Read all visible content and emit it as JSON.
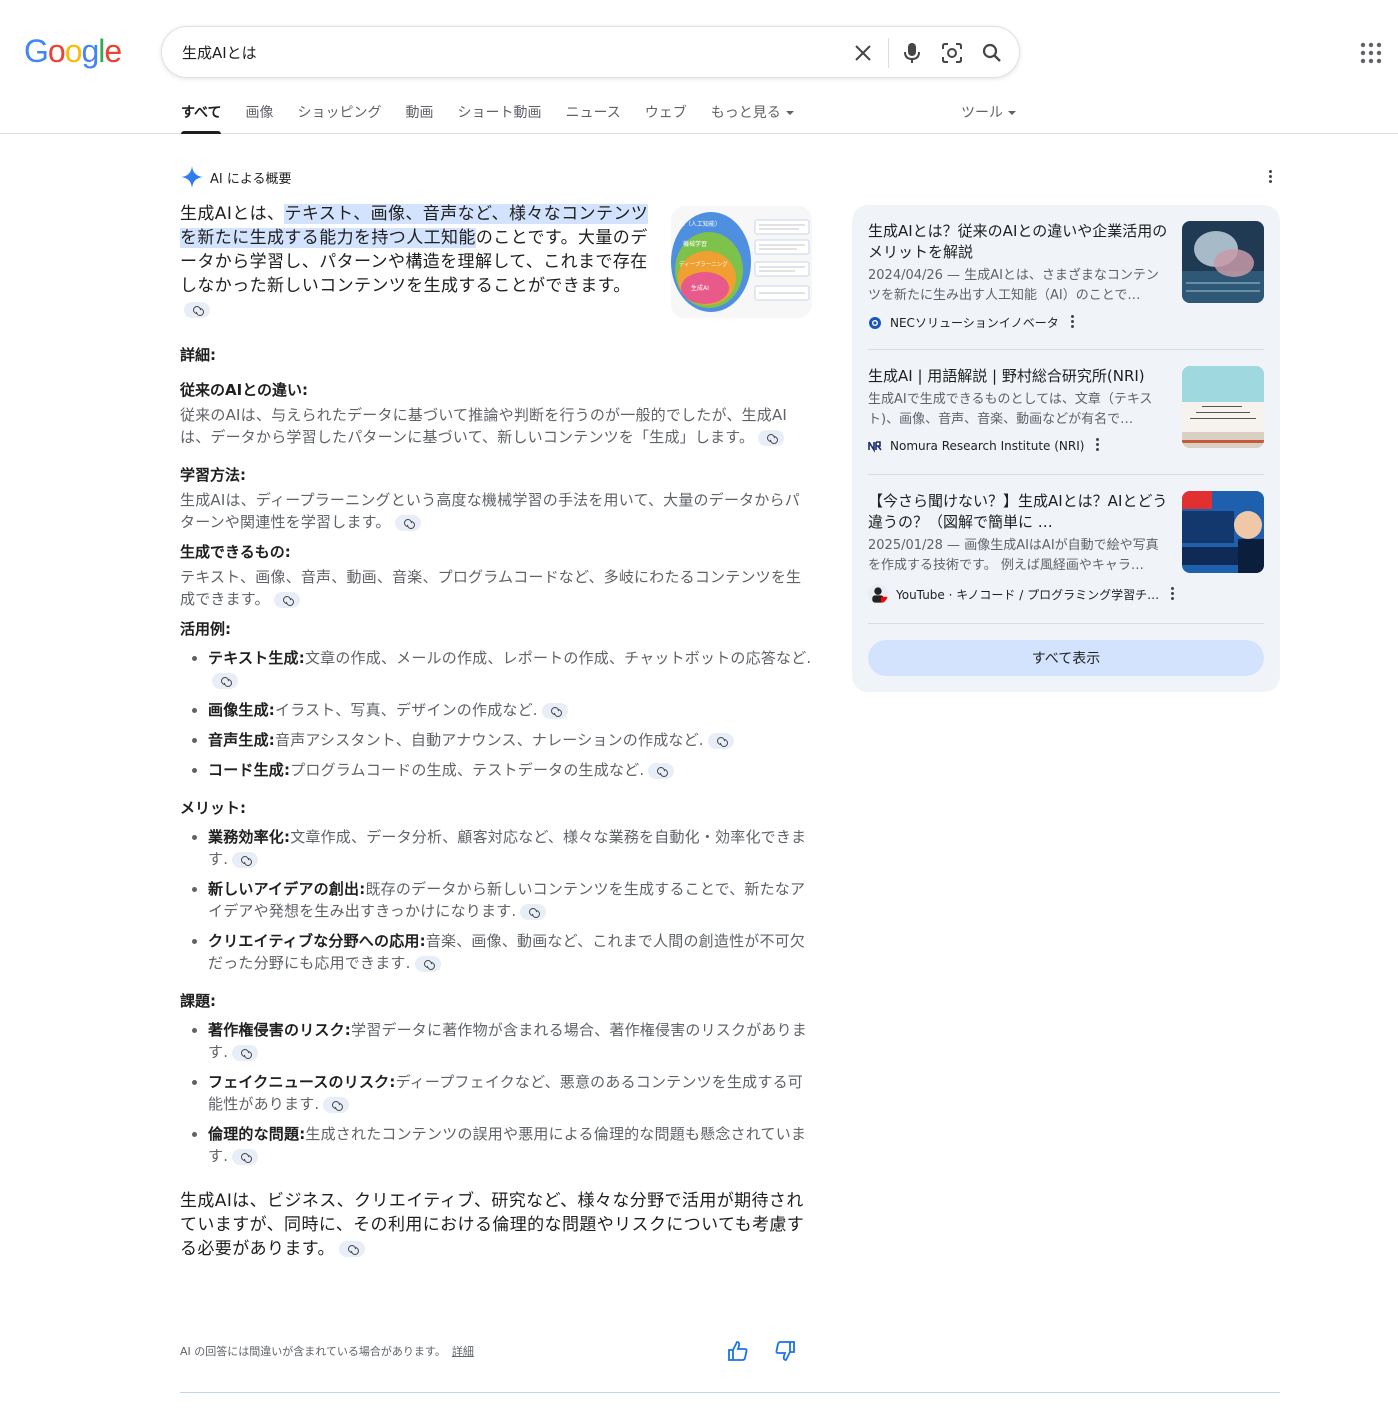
{
  "header": {
    "logo": [
      "G",
      "o",
      "o",
      "g",
      "l",
      "e"
    ],
    "logo_colors": [
      "#4285F4",
      "#EA4335",
      "#FBBC05",
      "#4285F4",
      "#34A853",
      "#EA4335"
    ],
    "query": "生成AIとは",
    "tabs": [
      "すべて",
      "画像",
      "ショッピング",
      "動画",
      "ショート動画",
      "ニュース",
      "ウェブ",
      "もっと見る"
    ],
    "tools": "ツール"
  },
  "ai": {
    "header_label": "AI による概要",
    "lead_pre": "生成AIとは、",
    "lead_hl": "テキスト、画像、音声など、様々なコンテンツを新たに生成する能力を持つ人工知能",
    "lead_post": "のことです。大量のデータから学習し、パターンや構造を理解して、これまで存在しなかった新しいコンテンツを生成することができます。",
    "details_title": "詳細:",
    "diff_title": "従来のAIとの違い:",
    "diff_text": "従来のAIは、与えられたデータに基づいて推論や判断を行うのが一般的でしたが、生成AIは、データから学習したパターンに基づいて、新しいコンテンツを「生成」します。",
    "learn_title": "学習方法:",
    "learn_text": "生成AIは、ディープラーニングという高度な機械学習の手法を用いて、大量のデータからパターンや関連性を学習します。",
    "can_title": "生成できるもの:",
    "can_text": "テキスト、画像、音声、動画、音楽、プログラムコードなど、多岐にわたるコンテンツを生成できます。",
    "use_title": "活用例:",
    "use_items": [
      {
        "b": "テキスト生成:",
        "t": "文章の作成、メールの作成、レポートの作成、チャットボットの応答など."
      },
      {
        "b": "画像生成:",
        "t": "イラスト、写真、デザインの作成など."
      },
      {
        "b": "音声生成:",
        "t": "音声アシスタント、自動アナウンス、ナレーションの作成など."
      },
      {
        "b": "コード生成:",
        "t": "プログラムコードの生成、テストデータの生成など."
      }
    ],
    "merit_title": "メリット:",
    "merit_items": [
      {
        "b": "業務効率化:",
        "t": "文章作成、データ分析、顧客対応など、様々な業務を自動化・効率化できます."
      },
      {
        "b": "新しいアイデアの創出:",
        "t": "既存のデータから新しいコンテンツを生成することで、新たなアイデアや発想を生み出すきっかけになります."
      },
      {
        "b": "クリエイティブな分野への応用:",
        "t": "音楽、画像、動画など、これまで人間の創造性が不可欠だった分野にも応用できます."
      }
    ],
    "issue_title": "課題:",
    "issue_items": [
      {
        "b": "著作権侵害のリスク:",
        "t": "学習データに著作物が含まれる場合、著作権侵害のリスクがあります."
      },
      {
        "b": "フェイクニュースのリスク:",
        "t": "ディープフェイクなど、悪意のあるコンテンツを生成する可能性があります."
      },
      {
        "b": "倫理的な問題:",
        "t": "生成されたコンテンツの誤用や悪用による倫理的な問題も懸念されています."
      }
    ],
    "closing": "生成AIは、ビジネス、クリエイティブ、研究など、様々な分野で活用が期待されていますが、同時に、その利用における倫理的な問題やリスクについても考慮する必要があります。",
    "footnote": "AI の回答には間違いが含まれている場合があります。",
    "footnote_link": "詳細",
    "diagram_labels": [
      "AI（人工知能）",
      "機械学習",
      "ディープラーニング",
      "生成AI"
    ],
    "diagram_colors": [
      "#4f8fe0",
      "#7dc24b",
      "#f0a030",
      "#e85a8a"
    ]
  },
  "sources": {
    "cards": [
      {
        "title": "生成AIとは？従来のAIとの違いや企業活用のメリットを解説",
        "snippet": "2024/04/26 — 生成AIとは、さまざまなコンテンツを新たに生み出す人工知能（AI）のことで…",
        "source": "NECソリューションイノベータ"
      },
      {
        "title": "生成AI | 用語解説 | 野村総合研究所(NRI)",
        "snippet": "生成AIで生成できるものとしては、文章（テキスト)、画像、音声、音楽、動画などが有名で…",
        "source": "Nomura Research Institute (NRI)"
      },
      {
        "title": "【今さら聞けない？】生成AIとは？AIとどう違うの？（図解で簡単に …",
        "snippet": "2025/01/28 — 画像生成AIはAIが自動で絵や写真を作成する技術です。 例えば風経画やキャラ…",
        "source": "YouTube · キノコード / プログラミング学習チ…"
      }
    ],
    "show_all": "すべて表示"
  }
}
